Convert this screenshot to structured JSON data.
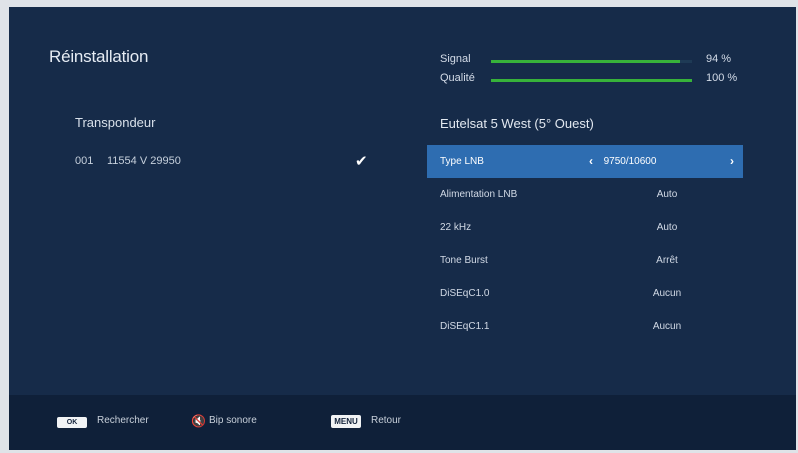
{
  "header": {
    "title": "Réinstallation"
  },
  "meters": [
    {
      "label": "Signal",
      "value": 94,
      "display": "94 %"
    },
    {
      "label": "Qualité",
      "value": 100,
      "display": "100 %"
    }
  ],
  "transponders": {
    "header": "Transpondeur",
    "items": [
      {
        "num": "001",
        "desc": "11554 V 29950",
        "check": "✔"
      }
    ]
  },
  "satellite": {
    "name": "Eutelsat 5 West (5° Ouest)"
  },
  "settings": [
    {
      "label": "Type LNB",
      "value": "9750/10600",
      "arrow_left": "‹",
      "arrow_right": "›"
    },
    {
      "label": "Alimentation LNB",
      "value": "Auto"
    },
    {
      "label": "22 kHz",
      "value": "Auto"
    },
    {
      "label": "Tone Burst",
      "value": "Arrêt"
    },
    {
      "label": "DiSEqC1.0",
      "value": "Aucun"
    },
    {
      "label": "DiSEqC1.1",
      "value": "Aucun"
    }
  ],
  "footer": {
    "ok_key": "OK",
    "ok_label": "Rechercher",
    "mute_icon": "🔇",
    "mute_label": "Bip sonore",
    "menu_key": "MENU",
    "menu_label": "Retour"
  },
  "colors": {
    "background": "#162b49",
    "selected": "#2e6db1",
    "meter_fill": "#37b23a",
    "footer": "#0f2039"
  }
}
